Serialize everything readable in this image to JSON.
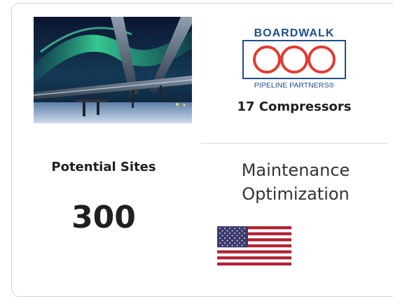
{
  "card": {
    "image": {
      "subject": "aurora-over-pipeline-photo"
    },
    "logo": {
      "name_top": "BOARDWALK",
      "name_bottom": "PIPELINE PARTNERS®",
      "brand_color": "#1f4e8c",
      "accent_color": "#e03c31"
    },
    "compressors_text": "17 Compressors",
    "potential_sites": {
      "label": "Potential Sites",
      "value": "300"
    },
    "program": {
      "line1": "Maintenance",
      "line2": "Optimization"
    },
    "country_flag": "us-flag-icon"
  }
}
